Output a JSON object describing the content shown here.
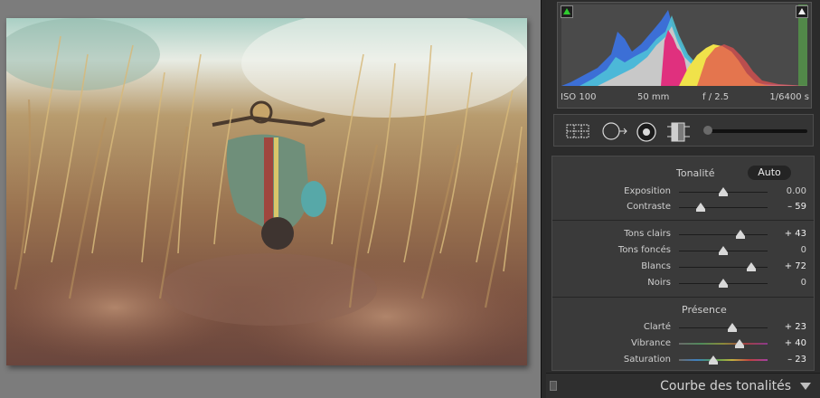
{
  "histogram": {
    "info": {
      "iso": "ISO 100",
      "focal": "50 mm",
      "aperture": "f / 2.5",
      "shutter": "1/6400 s"
    }
  },
  "tools": {
    "icons": [
      "crop-overlay-icon",
      "spot-removal-icon",
      "red-eye-icon",
      "graduated-filter-icon",
      "adjustment-brush-slider"
    ]
  },
  "basic": {
    "tone_title": "Tonalité",
    "auto_label": "Auto",
    "presence_title": "Présence",
    "rows": [
      {
        "label": "Exposition",
        "value": "0.00",
        "pos": 0.5
      },
      {
        "label": "Contraste",
        "value": "– 59",
        "pos": 0.24
      },
      {
        "label": "Tons clairs",
        "value": "+ 43",
        "pos": 0.69
      },
      {
        "label": "Tons foncés",
        "value": "0",
        "pos": 0.5
      },
      {
        "label": "Blancs",
        "value": "+ 72",
        "pos": 0.82
      },
      {
        "label": "Noirs",
        "value": "0",
        "pos": 0.5
      },
      {
        "label": "Clarté",
        "value": "+ 23",
        "pos": 0.6
      },
      {
        "label": "Vibrance",
        "value": "+ 40",
        "pos": 0.68
      },
      {
        "label": "Saturation",
        "value": "– 23",
        "pos": 0.39
      }
    ]
  },
  "curve": {
    "title": "Courbe des tonalités"
  },
  "colors": {
    "panel_bg": "#3a3a3a",
    "histo_blue": "#3c6fd6",
    "histo_cyan": "#4fc6d8",
    "histo_magenta": "#e0307e",
    "histo_yellow": "#f0e24a",
    "histo_red": "#e05050",
    "histo_gray": "#c8c8c8"
  }
}
